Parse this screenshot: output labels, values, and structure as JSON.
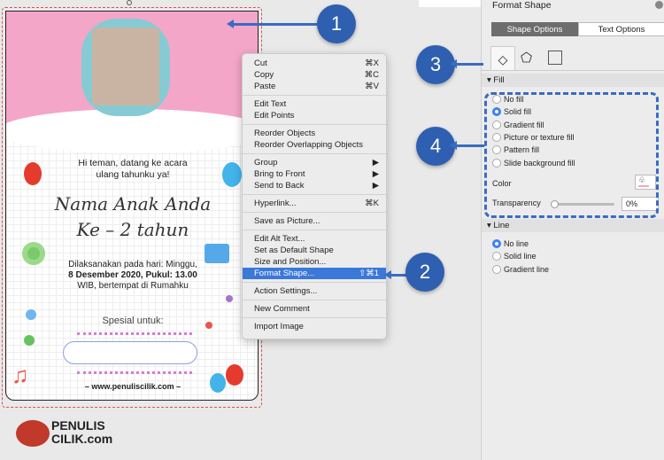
{
  "card": {
    "greeting1": "Hi teman, datang ke acara",
    "greeting2": "ulang tahunku ya!",
    "name": "Nama Anak Anda",
    "age": "Ke – 2 tahun",
    "details1": "Dilaksanakan pada hari: Minggu,",
    "details2": "8 Desember 2020, Pukul: 13.00",
    "details3": "WIB, bertempat di Rumahku",
    "special": "Spesial untuk:",
    "website": "– www.penuliscilik.com –"
  },
  "logo": {
    "line1": "PENULIS",
    "line2": "CILIK.com"
  },
  "menu": {
    "groups": [
      [
        {
          "label": "Cut",
          "shortcut": "⌘X"
        },
        {
          "label": "Copy",
          "shortcut": "⌘C"
        },
        {
          "label": "Paste",
          "shortcut": "⌘V"
        }
      ],
      [
        {
          "label": "Edit Text"
        },
        {
          "label": "Edit Points"
        }
      ],
      [
        {
          "label": "Reorder Objects"
        },
        {
          "label": "Reorder Overlapping Objects"
        }
      ],
      [
        {
          "label": "Group",
          "shortcut": "▶"
        },
        {
          "label": "Bring to Front",
          "shortcut": "▶"
        },
        {
          "label": "Send to Back",
          "shortcut": "▶"
        }
      ],
      [
        {
          "label": "Hyperlink...",
          "shortcut": "⌘K"
        }
      ],
      [
        {
          "label": "Save as Picture..."
        }
      ],
      [
        {
          "label": "Edit Alt Text..."
        },
        {
          "label": "Set as Default Shape"
        },
        {
          "label": "Size and Position..."
        },
        {
          "label": "Format Shape...",
          "shortcut": "⇧⌘1",
          "highlighted": true
        }
      ],
      [
        {
          "label": "Action Settings..."
        }
      ],
      [
        {
          "label": "New Comment"
        }
      ],
      [
        {
          "label": "Import Image"
        }
      ]
    ]
  },
  "panel": {
    "title": "Format Shape",
    "tabs": [
      "Shape Options",
      "Text Options"
    ],
    "active_tab": "Shape Options",
    "icons": [
      "fill-line-icon",
      "effects-pentagon-icon",
      "size-properties-icon"
    ],
    "fill_section": "Fill",
    "fill_options": [
      "No fill",
      "Solid fill",
      "Gradient fill",
      "Picture or texture fill",
      "Pattern fill",
      "Slide background fill"
    ],
    "fill_selected": "Solid fill",
    "color_label": "Color",
    "color_value": "#f4a6c8",
    "transparency_label": "Transparency",
    "transparency_value": "0%",
    "line_section": "Line",
    "line_options": [
      "No line",
      "Solid line",
      "Gradient line"
    ],
    "line_selected": "No line"
  },
  "callouts": [
    "1",
    "2",
    "3",
    "4"
  ],
  "accent": "#2f5fb0"
}
